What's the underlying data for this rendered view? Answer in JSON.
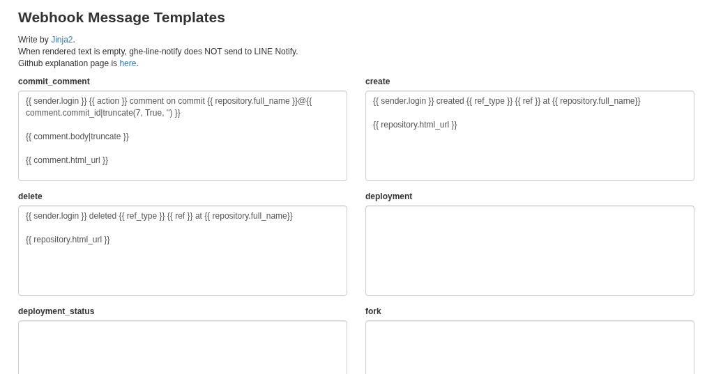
{
  "title": "Webhook Message Templates",
  "intro": [
    {
      "before": "Write by ",
      "link": "Jinja2",
      "after": "."
    },
    {
      "before": "When rendered text is empty, ghe-line-notify does NOT send to LINE Notify."
    },
    {
      "before": "Github explanation page is ",
      "link": "here",
      "after": "."
    }
  ],
  "templates": [
    {
      "label": "commit_comment",
      "value": "{{ sender.login }} {{ action }} comment on commit {{ repository.full_name }}@{{ comment.commit_id|truncate(7, True, '') }}\n\n{{ comment.body|truncate }}\n\n{{ comment.html_url }}"
    },
    {
      "label": "create",
      "value": "{{ sender.login }} created {{ ref_type }} {{ ref }} at {{ repository.full_name}}\n\n{{ repository.html_url }}"
    },
    {
      "label": "delete",
      "value": "{{ sender.login }} deleted {{ ref_type }} {{ ref }} at {{ repository.full_name}}\n\n{{ repository.html_url }}"
    },
    {
      "label": "deployment"
    },
    {
      "label": "deployment_status"
    },
    {
      "label": "fork"
    }
  ]
}
